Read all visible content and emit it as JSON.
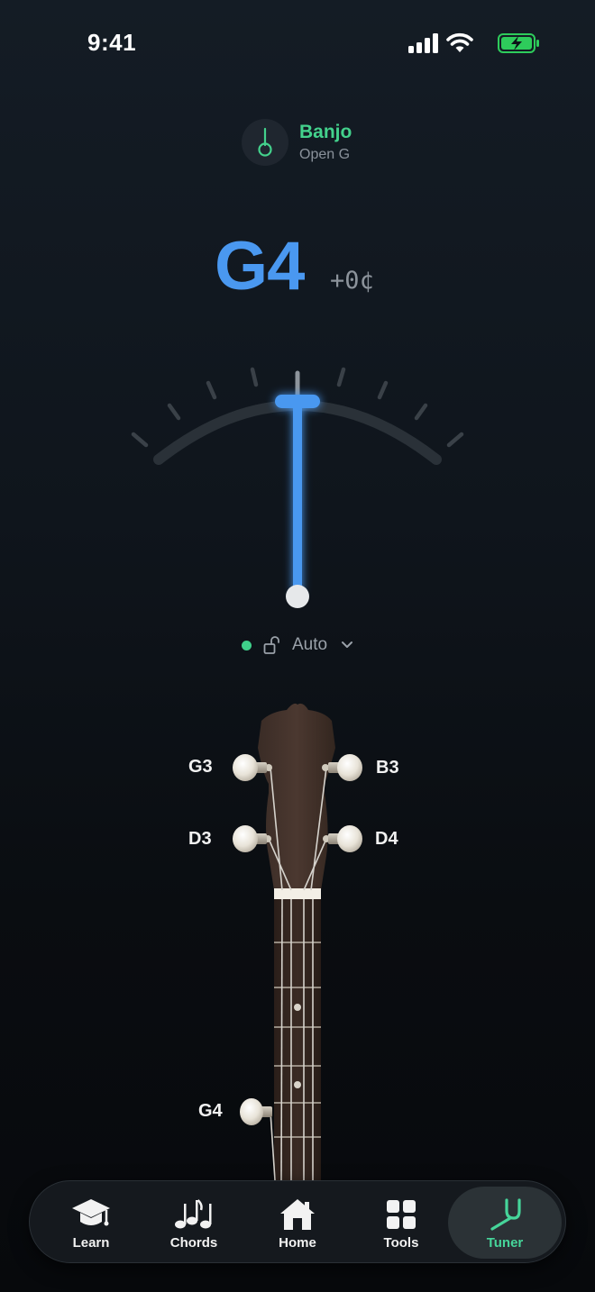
{
  "status": {
    "time": "9:41"
  },
  "instrument": {
    "name": "Banjo",
    "tuning": "Open G",
    "icon": "banjo-icon"
  },
  "reading": {
    "note": "G4",
    "cents": "+0¢",
    "cents_value": 0
  },
  "mode": {
    "label": "Auto",
    "locked": false
  },
  "strings": [
    {
      "label": "G3"
    },
    {
      "label": "B3"
    },
    {
      "label": "D3"
    },
    {
      "label": "D4"
    },
    {
      "label": "G4"
    }
  ],
  "tabs": [
    {
      "label": "Learn",
      "icon": "graduation-cap-icon"
    },
    {
      "label": "Chords",
      "icon": "music-notes-icon"
    },
    {
      "label": "Home",
      "icon": "home-icon"
    },
    {
      "label": "Tools",
      "icon": "grid-icon"
    },
    {
      "label": "Tuner",
      "icon": "tuning-fork-icon",
      "active": true
    }
  ],
  "colors": {
    "accent": "#4a98f0",
    "brand": "#43d18c",
    "active_tab": "#46d59a"
  }
}
